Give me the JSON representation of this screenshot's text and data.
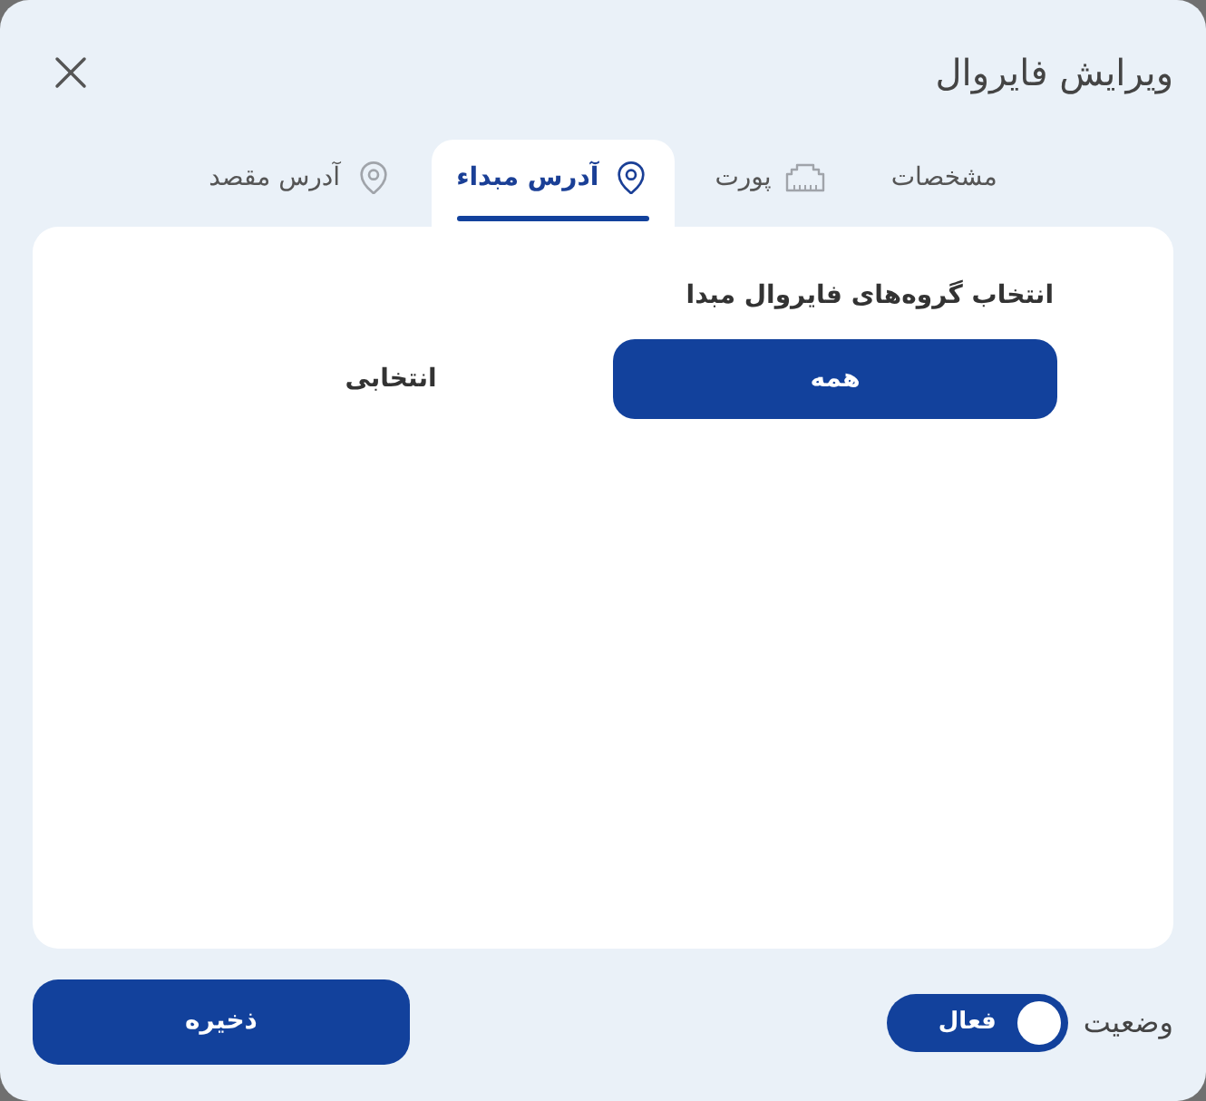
{
  "dialog": {
    "title": "ویرایش فایروال"
  },
  "tabs": [
    {
      "label": "مشخصات",
      "selected": false,
      "kind": "plain"
    },
    {
      "label": "پورت",
      "selected": false,
      "kind": "port"
    },
    {
      "label": "آدرس مبداء",
      "selected": true,
      "kind": "address"
    },
    {
      "label": "آدرس مقصد",
      "selected": false,
      "kind": "address"
    }
  ],
  "source_groups": {
    "label": "انتخاب گروه‌های فایروال مبدا",
    "options": [
      {
        "label": "همه",
        "selected": true
      },
      {
        "label": "انتخابی",
        "selected": false
      }
    ]
  },
  "footer": {
    "status": {
      "label": "وضعیت",
      "on": true,
      "state_label": "فعال"
    },
    "save_button": "ذخیره"
  }
}
